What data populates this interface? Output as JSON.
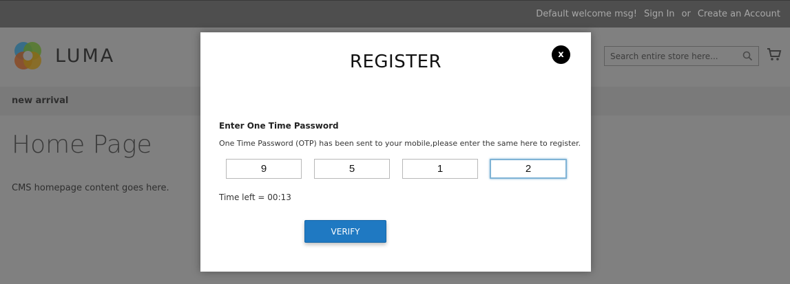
{
  "top_bar": {
    "welcome": "Default welcome msg!",
    "sign_in": "Sign In",
    "or": "or",
    "create_account": "Create an Account"
  },
  "header": {
    "logo_text": "LUMA",
    "search": {
      "placeholder": "Search entire store here..."
    }
  },
  "nav": {
    "items": [
      {
        "label": "new arrival"
      }
    ]
  },
  "page": {
    "title": "Home Page",
    "content": "CMS homepage content goes here."
  },
  "modal": {
    "title": "REGISTER",
    "close_label": "x",
    "otp_heading": "Enter One Time Password",
    "otp_description": "One Time Password (OTP) has been sent to your mobile,please enter the same here to register.",
    "otp_digits": [
      "9",
      "5",
      "1",
      "2"
    ],
    "time_left": "Time left = 00:13",
    "verify_label": "VERIFY"
  },
  "colors": {
    "verify_button": "#1f79c2",
    "overlay": "#808080",
    "top_bar": "#4e4e4e"
  }
}
